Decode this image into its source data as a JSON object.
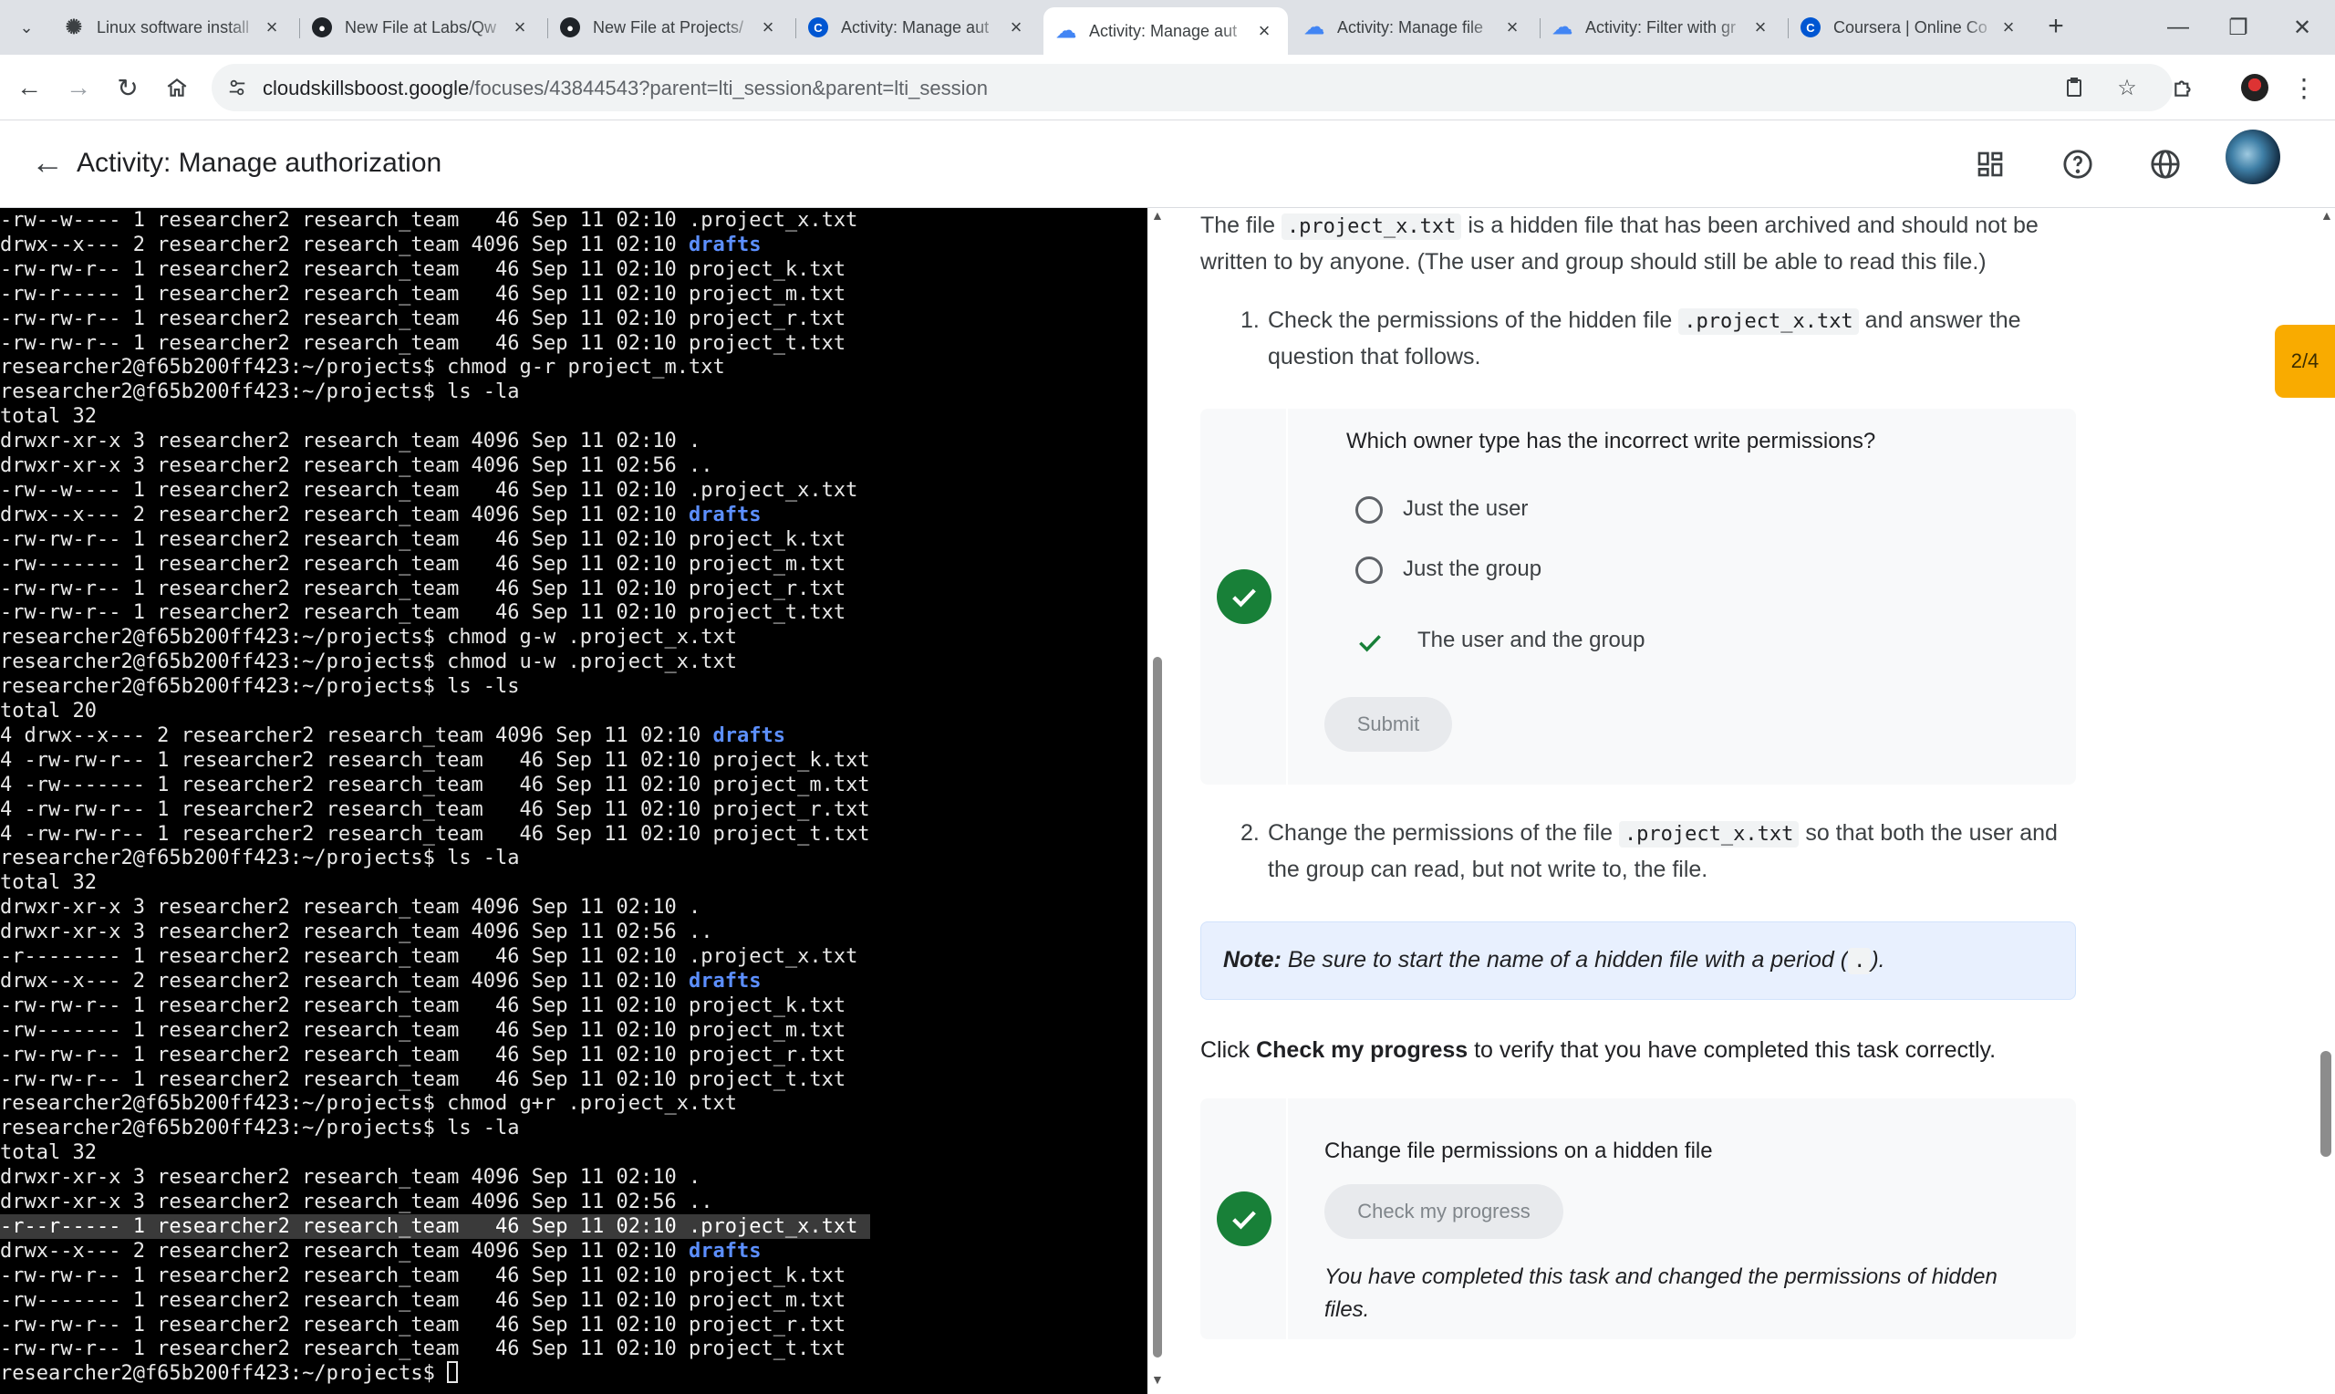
{
  "browser": {
    "tabs": [
      {
        "title": "Linux software install",
        "icon": "openai-icon"
      },
      {
        "title": "New File at Labs/Qw",
        "icon": "github-icon"
      },
      {
        "title": "New File at Projects/",
        "icon": "github-icon"
      },
      {
        "title": "Activity: Manage aut",
        "icon": "coursera-icon"
      },
      {
        "title": "Activity: Manage aut",
        "icon": "google-cloud-icon",
        "active": true
      },
      {
        "title": "Activity: Manage file",
        "icon": "google-cloud-icon"
      },
      {
        "title": "Activity: Filter with gr",
        "icon": "google-cloud-icon"
      },
      {
        "title": "Coursera | Online Co",
        "icon": "coursera-icon"
      }
    ],
    "url_host": "cloudskillsboost.google",
    "url_path": "/focuses/43844543?parent=lti_session&parent=lti_session"
  },
  "header": {
    "title": "Activity: Manage authorization"
  },
  "terminal": {
    "lines": [
      {
        "t": "-rw--w---- 1 researcher2 research_team   46 Sep 11 02:10 .project_x.txt"
      },
      {
        "t": "drwx--x--- 2 researcher2 research_team 4096 Sep 11 02:10 ",
        "dir": "drafts"
      },
      {
        "t": "-rw-rw-r-- 1 researcher2 research_team   46 Sep 11 02:10 project_k.txt"
      },
      {
        "t": "-rw-r----- 1 researcher2 research_team   46 Sep 11 02:10 project_m.txt"
      },
      {
        "t": "-rw-rw-r-- 1 researcher2 research_team   46 Sep 11 02:10 project_r.txt"
      },
      {
        "t": "-rw-rw-r-- 1 researcher2 research_team   46 Sep 11 02:10 project_t.txt"
      },
      {
        "t": "researcher2@f65b200ff423:~/projects$ chmod g-r project_m.txt"
      },
      {
        "t": "researcher2@f65b200ff423:~/projects$ ls -la"
      },
      {
        "t": "total 32"
      },
      {
        "t": "drwxr-xr-x 3 researcher2 research_team 4096 Sep 11 02:10 ."
      },
      {
        "t": "drwxr-xr-x 3 researcher2 research_team 4096 Sep 11 02:56 .."
      },
      {
        "t": "-rw--w---- 1 researcher2 research_team   46 Sep 11 02:10 .project_x.txt"
      },
      {
        "t": "drwx--x--- 2 researcher2 research_team 4096 Sep 11 02:10 ",
        "dir": "drafts"
      },
      {
        "t": "-rw-rw-r-- 1 researcher2 research_team   46 Sep 11 02:10 project_k.txt"
      },
      {
        "t": "-rw------- 1 researcher2 research_team   46 Sep 11 02:10 project_m.txt"
      },
      {
        "t": "-rw-rw-r-- 1 researcher2 research_team   46 Sep 11 02:10 project_r.txt"
      },
      {
        "t": "-rw-rw-r-- 1 researcher2 research_team   46 Sep 11 02:10 project_t.txt"
      },
      {
        "t": "researcher2@f65b200ff423:~/projects$ chmod g-w .project_x.txt"
      },
      {
        "t": "researcher2@f65b200ff423:~/projects$ chmod u-w .project_x.txt"
      },
      {
        "t": "researcher2@f65b200ff423:~/projects$ ls -ls"
      },
      {
        "t": "total 20"
      },
      {
        "t": "4 drwx--x--- 2 researcher2 research_team 4096 Sep 11 02:10 ",
        "dir": "drafts"
      },
      {
        "t": "4 -rw-rw-r-- 1 researcher2 research_team   46 Sep 11 02:10 project_k.txt"
      },
      {
        "t": "4 -rw------- 1 researcher2 research_team   46 Sep 11 02:10 project_m.txt"
      },
      {
        "t": "4 -rw-rw-r-- 1 researcher2 research_team   46 Sep 11 02:10 project_r.txt"
      },
      {
        "t": "4 -rw-rw-r-- 1 researcher2 research_team   46 Sep 11 02:10 project_t.txt"
      },
      {
        "t": "researcher2@f65b200ff423:~/projects$ ls -la"
      },
      {
        "t": "total 32"
      },
      {
        "t": "drwxr-xr-x 3 researcher2 research_team 4096 Sep 11 02:10 ."
      },
      {
        "t": "drwxr-xr-x 3 researcher2 research_team 4096 Sep 11 02:56 .."
      },
      {
        "t": "-r-------- 1 researcher2 research_team   46 Sep 11 02:10 .project_x.txt"
      },
      {
        "t": "drwx--x--- 2 researcher2 research_team 4096 Sep 11 02:10 ",
        "dir": "drafts"
      },
      {
        "t": "-rw-rw-r-- 1 researcher2 research_team   46 Sep 11 02:10 project_k.txt"
      },
      {
        "t": "-rw------- 1 researcher2 research_team   46 Sep 11 02:10 project_m.txt"
      },
      {
        "t": "-rw-rw-r-- 1 researcher2 research_team   46 Sep 11 02:10 project_r.txt"
      },
      {
        "t": "-rw-rw-r-- 1 researcher2 research_team   46 Sep 11 02:10 project_t.txt"
      },
      {
        "t": "researcher2@f65b200ff423:~/projects$ chmod g+r .project_x.txt"
      },
      {
        "t": "researcher2@f65b200ff423:~/projects$ ls -la"
      },
      {
        "t": "total 32"
      },
      {
        "t": "drwxr-xr-x 3 researcher2 research_team 4096 Sep 11 02:10 ."
      },
      {
        "t": "drwxr-xr-x 3 researcher2 research_team 4096 Sep 11 02:56 .."
      },
      {
        "t": "-r--r----- 1 researcher2 research_team   46 Sep 11 02:10 .project_x.txt ",
        "hl": true
      },
      {
        "t": "drwx--x--- 2 researcher2 research_team 4096 Sep 11 02:10 ",
        "dir": "drafts"
      },
      {
        "t": "-rw-rw-r-- 1 researcher2 research_team   46 Sep 11 02:10 project_k.txt"
      },
      {
        "t": "-rw------- 1 researcher2 research_team   46 Sep 11 02:10 project_m.txt"
      },
      {
        "t": "-rw-rw-r-- 1 researcher2 research_team   46 Sep 11 02:10 project_r.txt"
      },
      {
        "t": "-rw-rw-r-- 1 researcher2 research_team   46 Sep 11 02:10 project_t.txt"
      },
      {
        "t": "researcher2@f65b200ff423:~/projects$ ",
        "cursor": true
      }
    ]
  },
  "lab": {
    "intro_part1": "The file ",
    "intro_code": ".project_x.txt",
    "intro_part2": " is a hidden file that has been archived and should not be",
    "intro_line2": "written to by anyone. (The user and group should still be able to read this file.)",
    "step1_num": "1.",
    "step1_part1": "Check the permissions of the hidden file ",
    "step1_code": ".project_x.txt",
    "step1_part2": " and answer the",
    "step1_line2": "question that follows.",
    "quiz": {
      "question": "Which owner type has the incorrect write permissions?",
      "options": [
        "Just the user",
        "Just the group",
        "The user and the group"
      ],
      "selected_index": 2,
      "submit_label": "Submit"
    },
    "step2_num": "2.",
    "step2_part1": "Change the permissions of the file ",
    "step2_code": ".project_x.txt",
    "step2_part2": " so that both the user and",
    "step2_line2": "the group can read, but not write to, the file.",
    "note_label": "Note:",
    "note_text": " Be sure to start the name of a hidden file with a period (",
    "note_code": ".",
    "note_end": ").",
    "click_part1": "Click ",
    "click_bold": "Check my progress",
    "click_part2": " to verify that you have completed this task correctly.",
    "progress": {
      "title": "Change file permissions on a hidden file",
      "button_label": "Check my progress",
      "done_line1": "You have completed this task and changed the permissions of hidden",
      "done_line2": "files."
    },
    "page_badge": "2/4"
  },
  "colors": {
    "success_green": "#188038",
    "badge_amber": "#f9ab00",
    "terminal_bg": "#000000",
    "terminal_dir": "#5c8fff"
  }
}
